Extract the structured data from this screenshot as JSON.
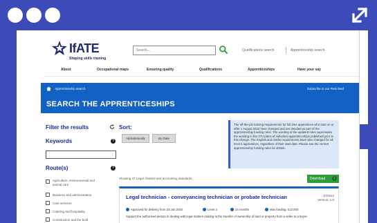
{
  "header": {
    "logo_text": "IfATE",
    "logo_tagline": "Shaping skills training",
    "search_placeholder": "Search...",
    "link_qualifications_search": "Qualifications search",
    "link_apprenticeship_search": "Apprenticeship search"
  },
  "nav": {
    "items": [
      "About",
      "Occupational maps",
      "Ensuring quality",
      "Qualifications",
      "Apprenticeships",
      "Have your say"
    ]
  },
  "banner": {
    "breadcrumb": "Apprenticeship search",
    "rss_link": "Subscribe to our RSS feed",
    "title": "SEARCH THE APPRENTICESHIPS"
  },
  "filters": {
    "title": "Filter the results",
    "keywords_label": "Keywords",
    "keywords_value": "",
    "routes_label": "Route(s)",
    "routes": [
      "Agriculture, environmental and animal care",
      "Business and administration",
      "Care services",
      "Catering and hospitality",
      "Construction and the built"
    ]
  },
  "sort": {
    "label": "Sort:",
    "options": [
      "Alphabetically",
      "By Date"
    ]
  },
  "notice": {
    "text": "The off-the-job training requirements for full time apprentices who start on or after 1 August 2022 have changed and are detailed as part of the apprenticeship funding rules. The wording in the updated rules supersedes the wording in the OTJ plans of individual apprenticeships published prior to this change. The English and maths requirements have also changed for all level 2 apprentices, regardless of their start date. Please see the current apprenticeship funding rules for details."
  },
  "results": {
    "showing_text": "Showing 47 Legal, finance and accounting standards",
    "download_label": "Download",
    "card": {
      "title": "Legal technician - conveyancing technician or probate technician",
      "ref": "ST0612",
      "version": "Version: 1.0",
      "status": "Approved for delivery from 23 Jan 2024",
      "level": "Level 4",
      "duration": "24 months",
      "funding": "Max funding: £12,000",
      "description": "Support the authorised person in dealing with legal matters relating to the transfer of ownership of land or property from a seller to a buyer."
    }
  },
  "colors": {
    "frame": "#3d4bb8",
    "banner": "#1261c3",
    "heading": "#1d2a9e",
    "download": "#2e9e3a",
    "notice_bg": "#dbe8f8"
  }
}
